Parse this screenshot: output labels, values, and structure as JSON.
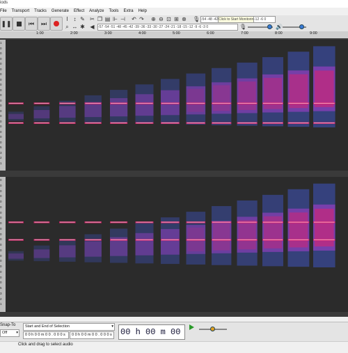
{
  "window": {
    "title": "iods"
  },
  "menu": [
    "File",
    "Transport",
    "Tracks",
    "Generate",
    "Effect",
    "Analyze",
    "Tools",
    "Extra",
    "Help"
  ],
  "toolbar": {
    "rec_meter_ticks": "-54  -48  -42",
    "monitor_prompt": "Click to Start Monitoring",
    "rec_meter_end": "-12  -6  0",
    "play_meter_ticks": "-57 -54 -51 -48 -45 -42 -39 -36 -33 -30 -27 -24 -21 -18 -15 -12  -9  -6  -3  0",
    "icons": {
      "pause": "pause-icon",
      "play": "play-icon",
      "stop": "stop-icon",
      "skip_start": "skip-to-start-icon",
      "skip_end": "skip-to-end-icon",
      "record": "record-icon"
    }
  },
  "timeline": {
    "ticks": [
      "1:00",
      "2:00",
      "3:00",
      "4:00",
      "5:00",
      "6:00",
      "7:00",
      "8:00",
      "9:00"
    ]
  },
  "tracks": [
    {
      "labels": [
        "1",
        "0",
        "0",
        "0",
        "0",
        "0",
        "0",
        "0",
        "0",
        "0",
        "0",
        "0",
        "0",
        "0",
        "0",
        "0",
        "0",
        "0",
        "0",
        "0",
        "5",
        "3",
        "2",
        "1"
      ]
    },
    {
      "labels": [
        "0",
        "0",
        "0",
        "0",
        "0",
        "0",
        "0",
        "0",
        "0",
        "0",
        "0",
        "0",
        "0",
        "0",
        "0",
        "0",
        "0",
        "0",
        "0",
        "0",
        "5",
        "3",
        "2",
        "1"
      ]
    }
  ],
  "selection_toolbar": {
    "snap_label": "Snap-To",
    "snap_value": "Off",
    "selection_mode": "Start and End of Selection",
    "start_time": "0 0 h 0 0 m 0 0 . 0 0 0 s",
    "end_time": "0 0 h 0 0 m 0 0 . 0 0 0 s",
    "audio_position": "00 h 00 m 00 s"
  },
  "status": {
    "text": "Click and drag to select audio"
  },
  "colors": {
    "track_bg": "#2b2b2b",
    "spectro_low": "#3a4a9a",
    "spectro_mid": "#8a3fb8",
    "spectro_high": "#e0206a",
    "spectro_peak": "#ffffff"
  }
}
